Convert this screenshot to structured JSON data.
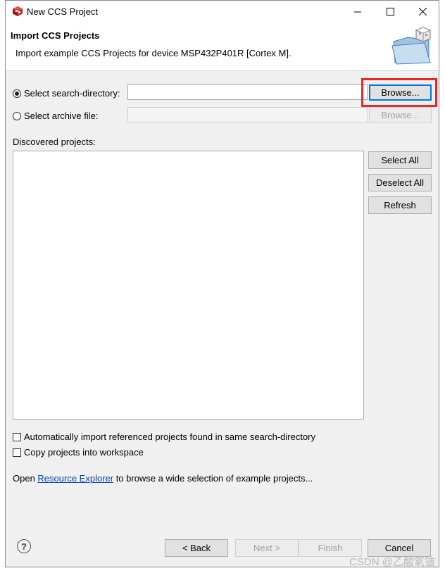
{
  "window": {
    "title": "New CCS Project"
  },
  "header": {
    "title": "Import CCS Projects",
    "description": "Import example CCS Projects for device MSP432P401R [Cortex M]."
  },
  "search_dir": {
    "label": "Select search-directory:",
    "value": "",
    "selected": true,
    "browse_label": "Browse..."
  },
  "archive": {
    "label": "Select archive file:",
    "value": "",
    "selected": false,
    "browse_label": "Browse..."
  },
  "discovered": {
    "label": "Discovered projects:",
    "items": [],
    "select_all": "Select All",
    "deselect_all": "Deselect All",
    "refresh": "Refresh"
  },
  "options": {
    "auto_import": "Automatically import referenced projects found in same search-directory",
    "copy_projects": "Copy projects into workspace"
  },
  "resource": {
    "prefix": "Open ",
    "link": "Resource Explorer",
    "suffix": " to browse a wide selection of example projects..."
  },
  "footer": {
    "back": "< Back",
    "next": "Next >",
    "finish": "Finish",
    "cancel": "Cancel"
  },
  "watermark": "CSDN @乙酸氧铍",
  "colors": {
    "highlight": "#e8262e",
    "link": "#0645ad",
    "focus": "#0078d7"
  },
  "icons": {
    "app": "ccs-cube-icon",
    "header": "folder-cube-icon",
    "help": "help-icon"
  }
}
